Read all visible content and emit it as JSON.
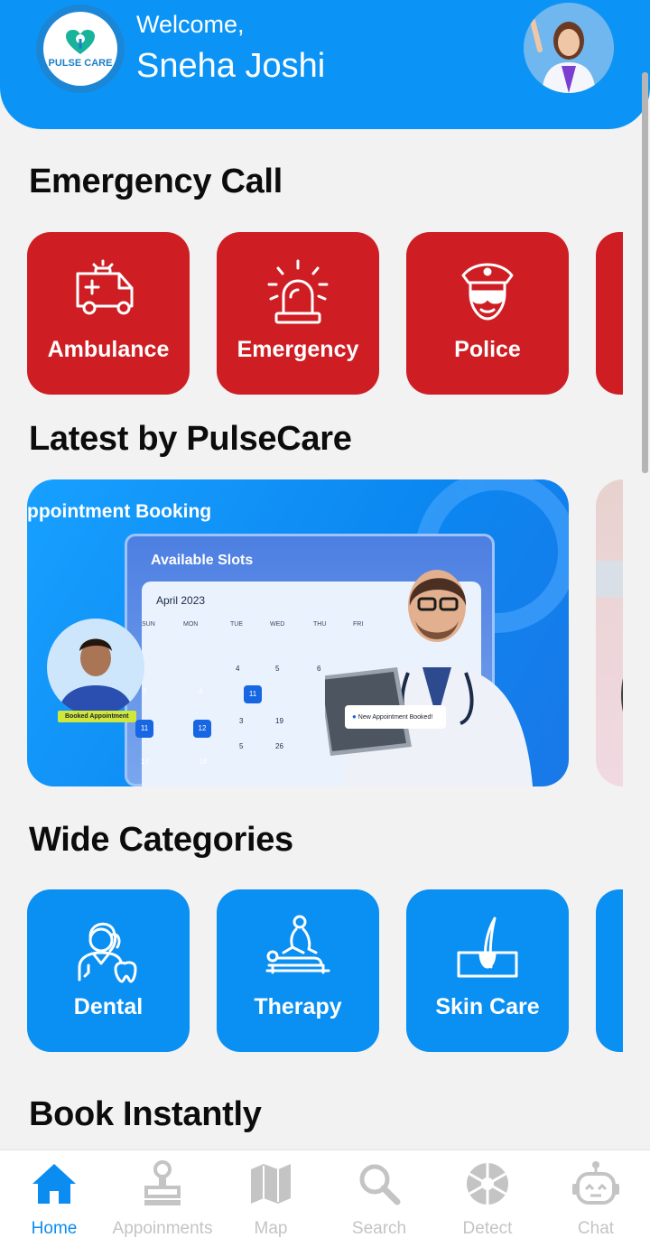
{
  "header": {
    "logo_text": "PULSE CARE",
    "welcome": "Welcome,",
    "user_name": "Sneha Joshi"
  },
  "emergency": {
    "title": "Emergency Call",
    "items": [
      {
        "label": "Ambulance",
        "icon": "ambulance-icon"
      },
      {
        "label": "Emergency",
        "icon": "siren-icon"
      },
      {
        "label": "Police",
        "icon": "police-icon"
      }
    ]
  },
  "latest": {
    "title": "Latest by PulseCare",
    "banner": {
      "heading": "ppointment Booking",
      "slots_title": "Available Slots",
      "month": "April 2023",
      "days": [
        "SUN",
        "MON",
        "TUE",
        "WED",
        "THU",
        "FRI"
      ],
      "booked_tag": "Booked Appointment",
      "notification": "New Appointment Booked!"
    }
  },
  "categories": {
    "title": "Wide Categories",
    "items": [
      {
        "label": "Dental",
        "icon": "dental-icon"
      },
      {
        "label": "Therapy",
        "icon": "therapy-icon"
      },
      {
        "label": "Skin Care",
        "icon": "skin-care-icon"
      }
    ]
  },
  "book": {
    "title": "Book Instantly"
  },
  "nav": {
    "items": [
      {
        "label": "Home",
        "icon": "home-icon",
        "active": true
      },
      {
        "label": "Appoinments",
        "icon": "appointments-icon"
      },
      {
        "label": "Map",
        "icon": "map-icon"
      },
      {
        "label": "Search",
        "icon": "search-icon"
      },
      {
        "label": "Detect",
        "icon": "detect-icon"
      },
      {
        "label": "Chat",
        "icon": "chat-bot-icon"
      }
    ]
  },
  "colors": {
    "primary": "#0b94f5",
    "emergency_red": "#ce1e24",
    "category_blue": "#0a8ff2",
    "nav_active": "#0b8cf0",
    "nav_inactive": "#c4c4c4"
  }
}
